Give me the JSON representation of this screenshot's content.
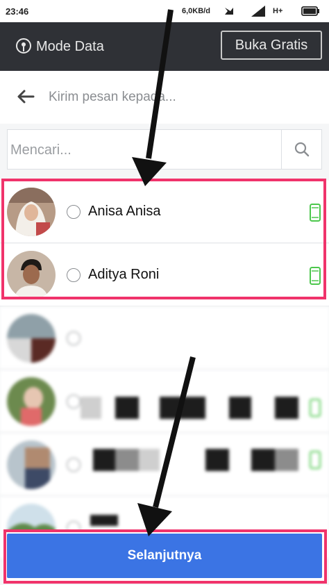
{
  "status_bar": {
    "time": "23:46",
    "speed": "6,0KB/d",
    "network": "H+"
  },
  "mode_bar": {
    "label": "Mode Data",
    "button": "Buka Gratis"
  },
  "header": {
    "title": "Kirim pesan kepada..."
  },
  "search": {
    "placeholder": "Mencari..."
  },
  "contacts": [
    {
      "name": "Anisa Anisa"
    },
    {
      "name": "Aditya Roni"
    }
  ],
  "footer": {
    "next_label": "Selanjutnya"
  },
  "colors": {
    "highlight": "#f0336b",
    "primary_button": "#3b74e4",
    "online_indicator": "#4cc74c",
    "mode_bar_bg": "#2f3136"
  }
}
